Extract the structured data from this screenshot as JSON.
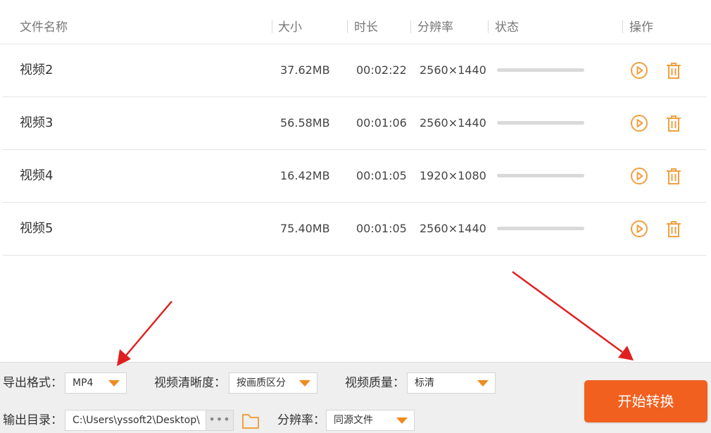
{
  "header": {
    "columns": {
      "name": "文件名称",
      "size": "大小",
      "duration": "时长",
      "resolution": "分辨率",
      "status": "状态",
      "actions": "操作"
    }
  },
  "files": [
    {
      "name": "视频2",
      "size": "37.62MB",
      "duration": "00:02:22",
      "resolution": "2560×1440",
      "progress": 0
    },
    {
      "name": "视频3",
      "size": "56.58MB",
      "duration": "00:01:06",
      "resolution": "2560×1440",
      "progress": 0
    },
    {
      "name": "视频4",
      "size": "16.42MB",
      "duration": "00:01:05",
      "resolution": "1920×1080",
      "progress": 0
    },
    {
      "name": "视频5",
      "size": "75.40MB",
      "duration": "00:01:05",
      "resolution": "2560×1440",
      "progress": 0
    }
  ],
  "settings": {
    "export_format": {
      "label": "导出格式：",
      "value": "MP4"
    },
    "clarity": {
      "label": "视频清晰度：",
      "value": "按画质区分"
    },
    "quality": {
      "label": "视频质量：",
      "value": "标清"
    },
    "output_dir": {
      "label": "输出目录：",
      "value": "C:\\Users\\yssoft2\\Desktop\\"
    },
    "resolution": {
      "label": "分辨率：",
      "value": "同源文件"
    },
    "browse_label": "•••"
  },
  "start_button": "开始转换",
  "colors": {
    "accent": "#f2601f",
    "icon": "#f0a040",
    "annotation": "#e02020"
  }
}
